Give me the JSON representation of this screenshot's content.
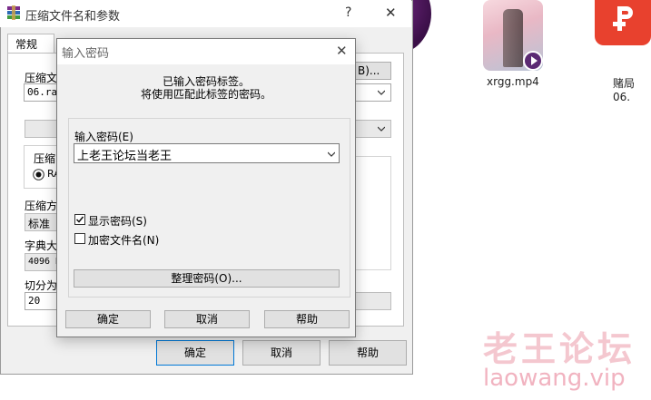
{
  "desktop": {
    "video_file": "xrgg.mp4",
    "doc_file": "赌局06.",
    "watermark_cn": "老王论坛",
    "watermark_url": "laowang.vip"
  },
  "archive_dialog": {
    "title": "压缩文件名和参数",
    "help_icon": "?",
    "close_icon": "✕",
    "tab_general": "常规",
    "label_archive_name": "压缩文",
    "archive_name_value": "06.ra",
    "browse_button_suffix": "B)...",
    "section_format": "压缩",
    "format_option": "RA",
    "label_method": "压缩方",
    "method_value": "标准",
    "label_dict": "字典大",
    "dict_value": "4096 K",
    "label_split": "切分为",
    "split_value": "20",
    "ok_button": "确定",
    "cancel_button": "取消",
    "help_button": "帮助"
  },
  "password_dialog": {
    "title": "输入密码",
    "close_icon": "✕",
    "info_line1": "已输入密码标签。",
    "info_line2": "将使用匹配此标签的密码。",
    "password_label": "输入密码(E)",
    "password_value": "上老王论坛当老王",
    "show_password_label": "显示密码(S)",
    "show_password_checked": true,
    "encrypt_names_label": "加密文件名(N)",
    "encrypt_names_checked": false,
    "organize_button": "整理密码(O)...",
    "ok_button": "确定",
    "cancel_button": "取消",
    "help_button": "帮助"
  }
}
